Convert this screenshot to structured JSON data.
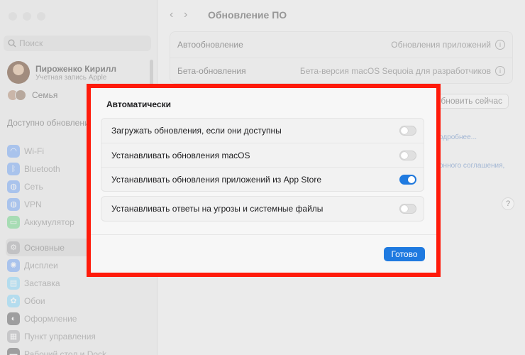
{
  "sidebar": {
    "search_placeholder": "Поиск",
    "profile_name": "Пироженко Кирилл",
    "profile_sub": "Учетная запись Apple",
    "family": "Семья",
    "update_line": "Доступно обновление",
    "items": [
      {
        "label": "Wi-Fi",
        "icon": "wifi-icon",
        "color": "#3b82f6"
      },
      {
        "label": "Bluetooth",
        "icon": "bluetooth-icon",
        "color": "#3b82f6"
      },
      {
        "label": "Сеть",
        "icon": "network-icon",
        "color": "#3b82f6"
      },
      {
        "label": "VPN",
        "icon": "vpn-icon",
        "color": "#3b82f6"
      },
      {
        "label": "Аккумулятор",
        "icon": "battery-icon",
        "color": "#34c759"
      },
      {
        "label": "Основные",
        "icon": "gear-icon",
        "color": "#8e8e93"
      },
      {
        "label": "Дисплеи",
        "icon": "display-icon",
        "color": "#3b82f6"
      },
      {
        "label": "Заставка",
        "icon": "screensaver-icon",
        "color": "#5ac8fa"
      },
      {
        "label": "Обои",
        "icon": "wallpaper-icon",
        "color": "#5ac8fa"
      },
      {
        "label": "Оформление",
        "icon": "appearance-icon",
        "color": "#1d1d1f"
      },
      {
        "label": "Пункт управления",
        "icon": "control-center-icon",
        "color": "#8e8e93"
      },
      {
        "label": "Рабочий стол и Dock",
        "icon": "dock-icon",
        "color": "#1d1d1f"
      }
    ]
  },
  "main": {
    "title": "Обновление ПО",
    "rows": [
      {
        "label": "Автообновление",
        "value": "Обновления приложений"
      },
      {
        "label": "Бета-обновления",
        "value": "Бета-версия macOS Sequoia для разработчиков"
      }
    ],
    "update_btn": "обновить сейчас",
    "more_link": "одробнее...",
    "license_link": "онного соглашения,",
    "help": "?"
  },
  "dialog": {
    "title": "Автоматически",
    "group1": [
      {
        "label": "Загружать обновления, если они доступны",
        "on": false
      },
      {
        "label": "Устанавливать обновления macOS",
        "on": false
      },
      {
        "label": "Устанавливать обновления приложений из App Store",
        "on": true
      }
    ],
    "group2": [
      {
        "label": "Устанавливать ответы на угрозы и системные файлы",
        "on": false
      }
    ],
    "done": "Готово"
  },
  "colors": {
    "accent": "#1f7ae0",
    "highlight_frame": "#ff1a0a"
  }
}
